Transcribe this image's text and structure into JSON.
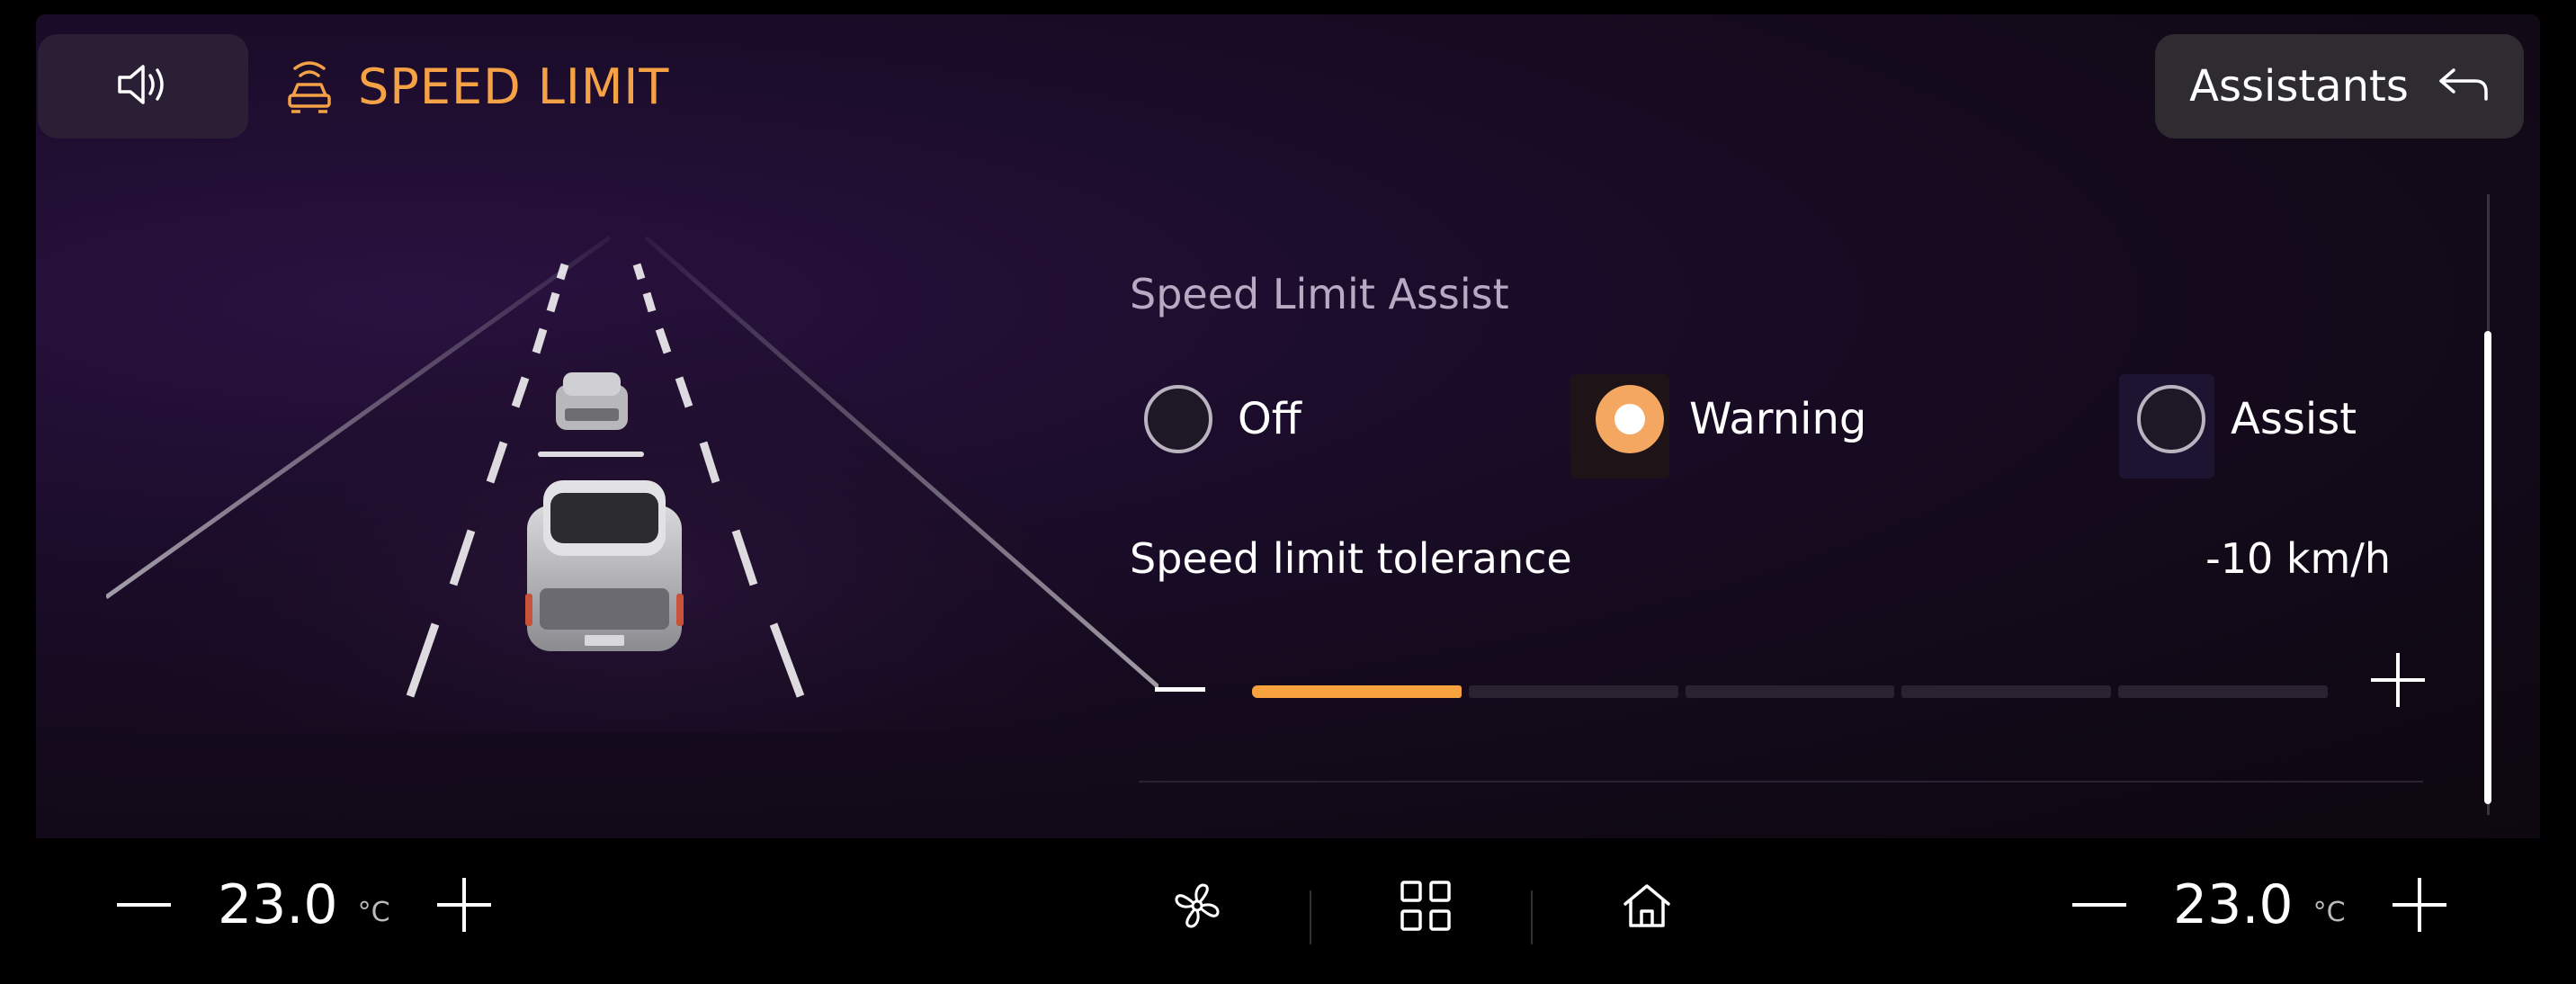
{
  "header": {
    "title": "SPEED LIMIT",
    "back_label": "Assistants"
  },
  "speed_limit_assist": {
    "section_title": "Speed Limit Assist",
    "options": [
      {
        "label": "Off",
        "selected": false
      },
      {
        "label": "Warning",
        "selected": true
      },
      {
        "label": "Assist",
        "selected": false
      }
    ]
  },
  "tolerance": {
    "label": "Speed limit tolerance",
    "value": "-10 km/h",
    "level_steps_total": 5,
    "level_steps_filled": 1
  },
  "climate": {
    "left_temp": "23.0",
    "right_temp": "23.0",
    "unit": "°C"
  },
  "colors": {
    "accent": "#f5a247",
    "selected_radio": "#f3a761",
    "background": "#1b0c2a"
  },
  "icons": {
    "volume": "speaker-icon",
    "feature": "car-radar-icon",
    "back": "back-arrow-icon",
    "fan": "fan-icon",
    "apps": "grid-icon",
    "home": "home-icon"
  }
}
